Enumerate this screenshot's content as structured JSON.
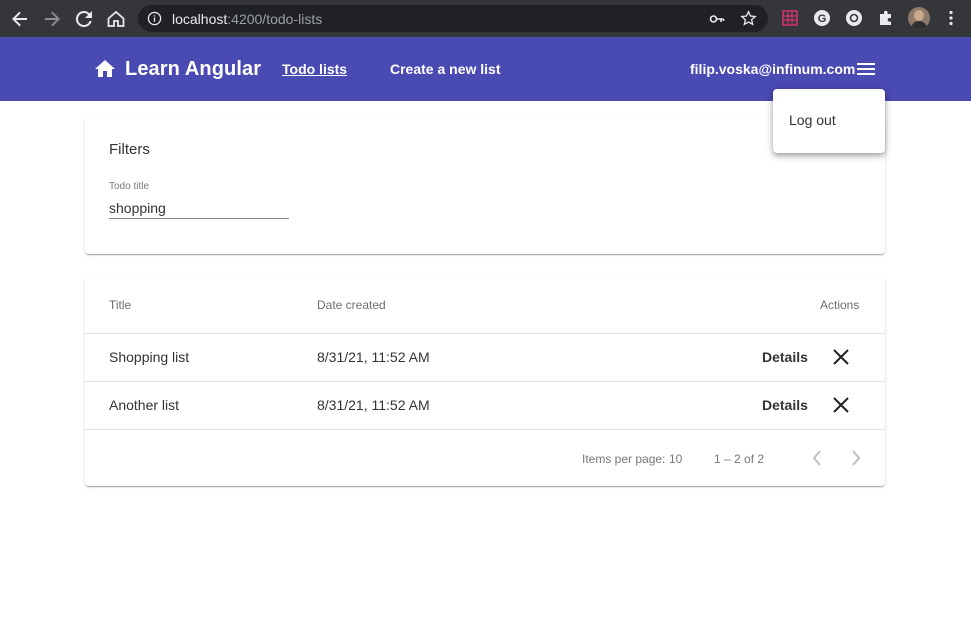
{
  "browser": {
    "url_host": "localhost",
    "url_path": ":4200/todo-lists"
  },
  "toolbar": {
    "brand_title": "Learn Angular",
    "nav_todo_lists": "Todo lists",
    "nav_create_list": "Create a new list",
    "user_email": "filip.voska@infinum.com",
    "accent_color": "#4a4ab3"
  },
  "user_menu": {
    "logout_label": "Log out"
  },
  "filters": {
    "heading": "Filters",
    "todo_title_label": "Todo title",
    "todo_title_value": "shopping"
  },
  "table": {
    "headers": {
      "title": "Title",
      "date_created": "Date created",
      "actions": "Actions"
    },
    "rows": [
      {
        "title": "Shopping list",
        "date_created": "8/31/21, 11:52 AM",
        "details_label": "Details"
      },
      {
        "title": "Another list",
        "date_created": "8/31/21, 11:52 AM",
        "details_label": "Details"
      }
    ],
    "paginator": {
      "items_per_page_label": "Items per page:",
      "items_per_page_value": "10",
      "range_label": "1 – 2 of 2"
    }
  },
  "icons": {
    "back": "back-arrow-icon",
    "forward": "forward-arrow-icon",
    "reload": "reload-icon",
    "home": "home-icon",
    "menu": "menu-icon",
    "delete": "close-icon",
    "prev": "chevron-left-icon",
    "next": "chevron-right-icon"
  }
}
